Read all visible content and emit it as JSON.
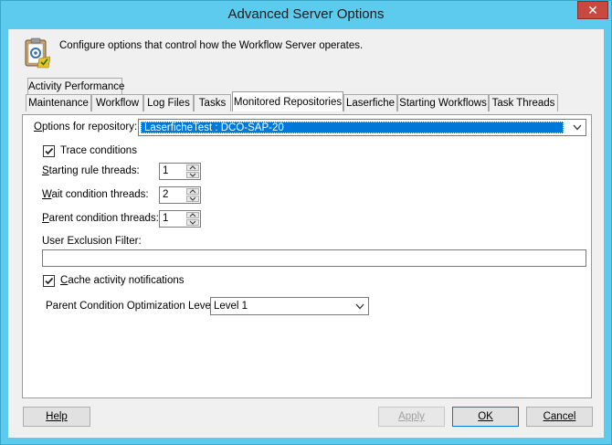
{
  "window": {
    "title": "Advanced Server Options",
    "close_glyph": "✕"
  },
  "header": {
    "description": "Configure options that control how the Workflow Server operates.",
    "icon": "clipboard-settings-icon"
  },
  "tabs": {
    "row1": [
      {
        "label": "Activity Performance"
      }
    ],
    "row2": [
      {
        "label": "Maintenance"
      },
      {
        "label": "Workflow"
      },
      {
        "label": "Log Files"
      },
      {
        "label": "Tasks"
      },
      {
        "label": "Monitored Repositories",
        "active": true
      },
      {
        "label": "Laserfiche"
      },
      {
        "label": "Starting Workflows"
      },
      {
        "label": "Task Threads"
      }
    ]
  },
  "panel": {
    "repo_label_first": "O",
    "repo_label_rest": "ptions for repository:",
    "repo_value": "LaserficheTest : DCO-SAP-20",
    "trace": {
      "label": "Trace conditions",
      "checked": true
    },
    "starting": {
      "label_first": "S",
      "label_rest": "tarting rule threads:",
      "value": "1"
    },
    "wait": {
      "label_first": "W",
      "label_rest": "ait condition threads:",
      "value": "2"
    },
    "parent": {
      "label_first": "P",
      "label_rest": "arent condition threads:",
      "value": "1"
    },
    "exclusion": {
      "label": "User Exclusion Filter:",
      "value": ""
    },
    "cache": {
      "label_first": "C",
      "label_rest": "ache activity notifications",
      "checked": true
    },
    "optimization": {
      "label": "Parent Condition Optimization Level:",
      "value": "Level 1"
    }
  },
  "buttons": {
    "help": "Help",
    "apply": "Apply",
    "ok": "OK",
    "cancel": "Cancel"
  },
  "colors": {
    "titlebar": "#5ccbee",
    "close": "#c7493f",
    "selection": "#0078d7"
  }
}
